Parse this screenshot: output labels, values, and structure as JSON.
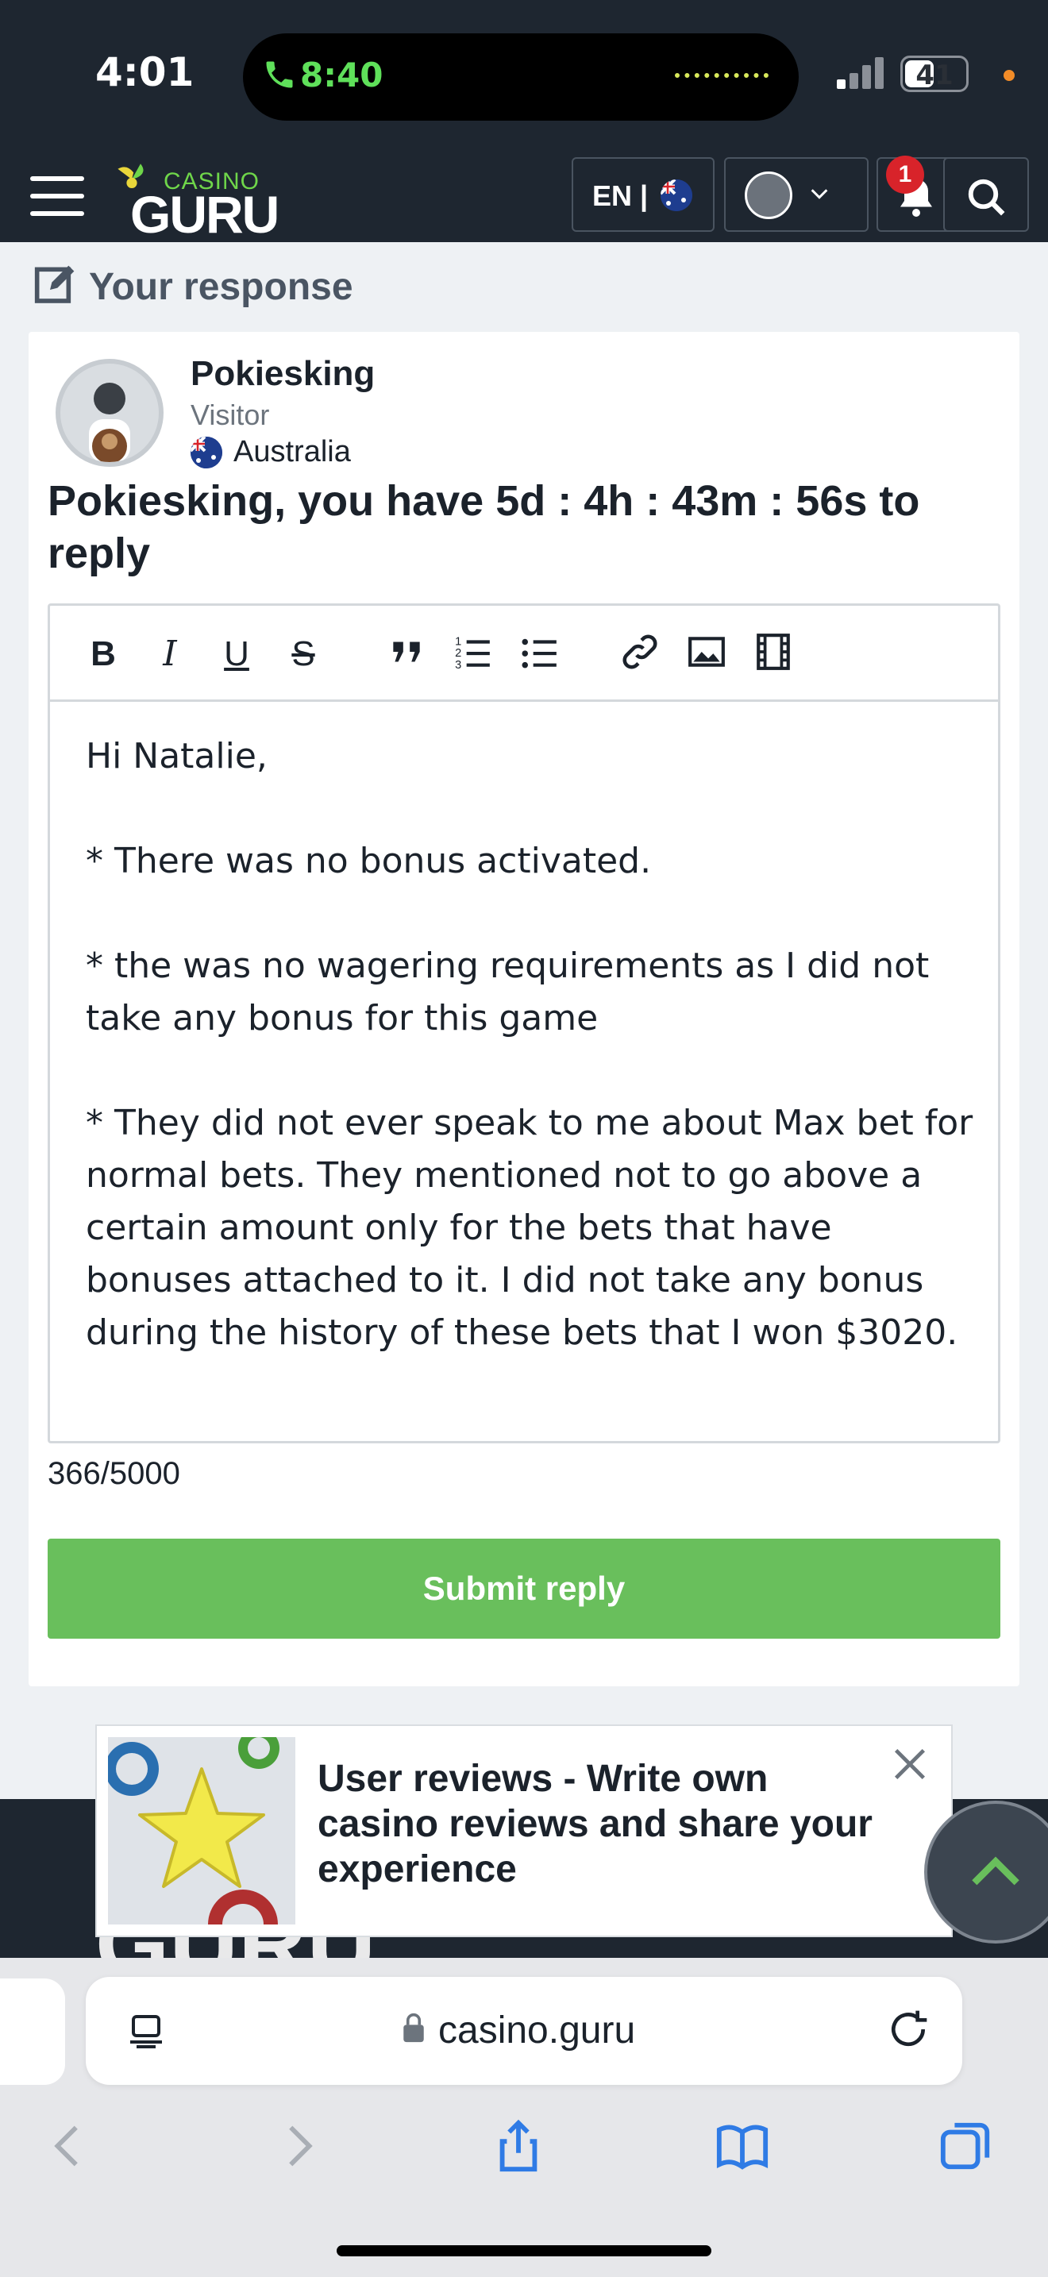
{
  "status": {
    "time": "4:01",
    "call_time": "8:40",
    "battery": "41"
  },
  "header": {
    "logo_top": "CASINO",
    "logo_main": "GURU",
    "lang_label": "EN |",
    "notifications_count": "1"
  },
  "response": {
    "section_title": "Your response",
    "user_name": "Pokiesking",
    "user_role": "Visitor",
    "user_country": "Australia",
    "countdown": "Pokiesking, you have 5d : 4h : 43m : 56s to reply",
    "toolbar": [
      "B",
      "I",
      "U",
      "S",
      "quote",
      "ordered-list",
      "bullet-list",
      "link",
      "image",
      "video"
    ],
    "body": "Hi Natalie,\n\n* There was no bonus activated.\n\n* the was no wagering requirements as I did not take any bonus for this game\n\n* They did not ever speak to me about Max bet for normal bets. They mentioned not to go above a certain amount only for the bets that have bonuses attached to it. I did not take any bonus during the history of these bets that I won $3020.",
    "char_count": "366/5000",
    "submit_label": "Submit reply"
  },
  "promo": {
    "text": "User reviews - Write own casino reviews and share your experience"
  },
  "footer": {
    "logo": "GURU"
  },
  "browser": {
    "url": "casino.guru"
  },
  "colors": {
    "accent_green": "#69bf5c",
    "header_dark": "#1e2630",
    "badge_red": "#d8232a"
  }
}
